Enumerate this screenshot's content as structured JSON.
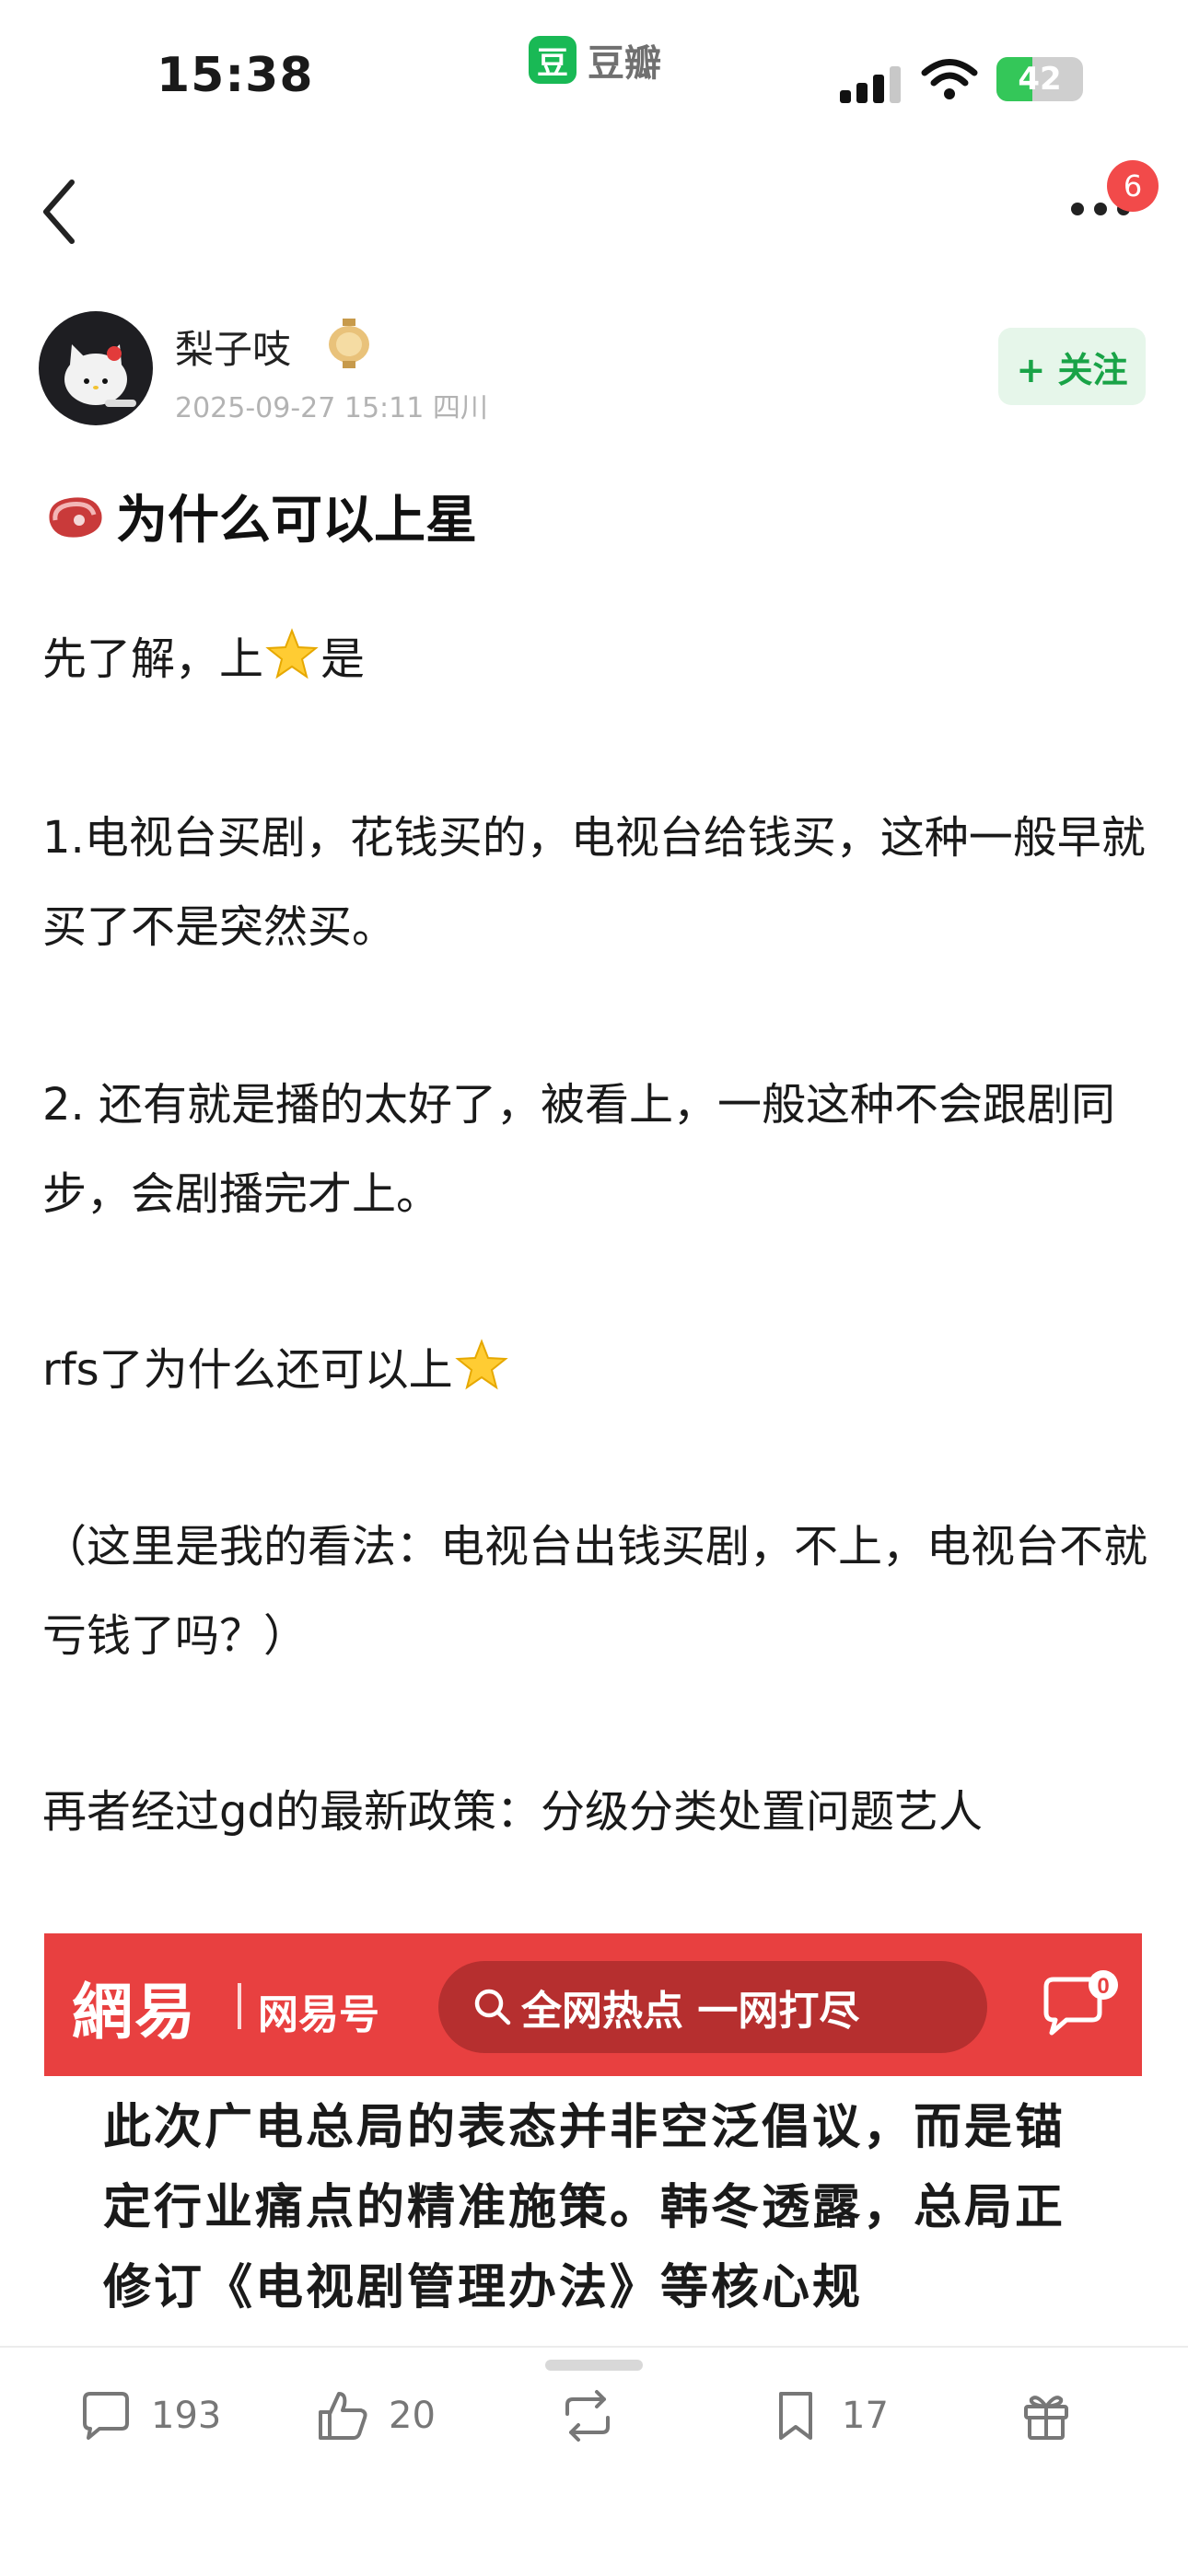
{
  "status_bar": {
    "time": "15:38",
    "app_name": "豆瓣",
    "app_logo_char": "豆",
    "battery": "42",
    "battery_level": 0.42
  },
  "nav": {
    "notification_count": "6"
  },
  "author": {
    "name": "梨子吱",
    "meta": "2025-09-27 15:11 四川",
    "follow_label": "+ 关注"
  },
  "post": {
    "title": "为什么可以上星",
    "p1_before": "先了解，上",
    "p1_after": "是",
    "p2": "1.电视台买剧，花钱买的，电视台给钱买，这种一般早就买了不是突然买。",
    "p3": "2. 还有就是播的太好了，被看上，一般这种不会跟剧同步，会剧播完才上。",
    "p4": "rfs了为什么还可以上",
    "p5": "（这里是我的看法：电视台出钱买剧，不上，电视台不就亏钱了吗？）",
    "p6": "再者经过gd的最新政策：分级分类处置问题艺人"
  },
  "embed": {
    "logo": "網易",
    "sub": "网易号",
    "search_placeholder": "全网热点 一网打尽",
    "msg_count": "0",
    "text": "此次广电总局的表态并非空泛倡议，而是锚定行业痛点的精准施策。韩冬透露，总局正修订《电视剧管理办法》等核心规"
  },
  "actions": {
    "comments": "193",
    "likes": "20",
    "reshares": "",
    "bookmarks": "17"
  },
  "colors": {
    "accent_green": "#19b955",
    "netease_red": "#e84040",
    "badge_red": "#f24a4a"
  },
  "icons": [
    "back-icon",
    "more-icon",
    "steak-icon",
    "star-icon",
    "search-icon",
    "message-icon",
    "comment-icon",
    "like-icon",
    "reshare-icon",
    "bookmark-icon",
    "gift-icon"
  ]
}
